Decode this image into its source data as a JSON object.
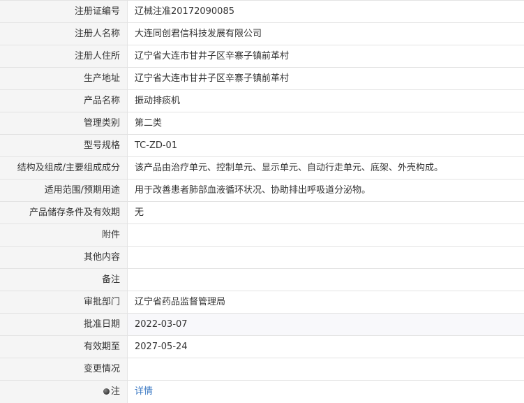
{
  "rows": [
    {
      "label": "注册证编号",
      "value": "辽械注准20172090085"
    },
    {
      "label": "注册人名称",
      "value": "大连同创君信科技发展有限公司"
    },
    {
      "label": "注册人住所",
      "value": "辽宁省大连市甘井子区辛寨子镇前革村"
    },
    {
      "label": "生产地址",
      "value": "辽宁省大连市甘井子区辛寨子镇前革村"
    },
    {
      "label": "产品名称",
      "value": "振动排痰机"
    },
    {
      "label": "管理类别",
      "value": "第二类"
    },
    {
      "label": "型号规格",
      "value": "TC-ZD-01"
    },
    {
      "label": "结构及组成/主要组成成分",
      "value": "该产品由治疗单元、控制单元、显示单元、自动行走单元、底架、外壳构成。"
    },
    {
      "label": "适用范围/预期用途",
      "value": "用于改善患者肺部血液循环状况、协助排出呼吸道分泌物。"
    },
    {
      "label": "产品储存条件及有效期",
      "value": "无"
    },
    {
      "label": "附件",
      "value": ""
    },
    {
      "label": "其他内容",
      "value": ""
    },
    {
      "label": "备注",
      "value": ""
    },
    {
      "label": "审批部门",
      "value": "辽宁省药品监督管理局"
    },
    {
      "label": "批准日期",
      "value": "2022-03-07"
    },
    {
      "label": "有效期至",
      "value": "2027-05-24"
    },
    {
      "label": "变更情况",
      "value": ""
    }
  ],
  "note": {
    "label": "注",
    "link_text": "详情",
    "icon": "pin-icon"
  }
}
